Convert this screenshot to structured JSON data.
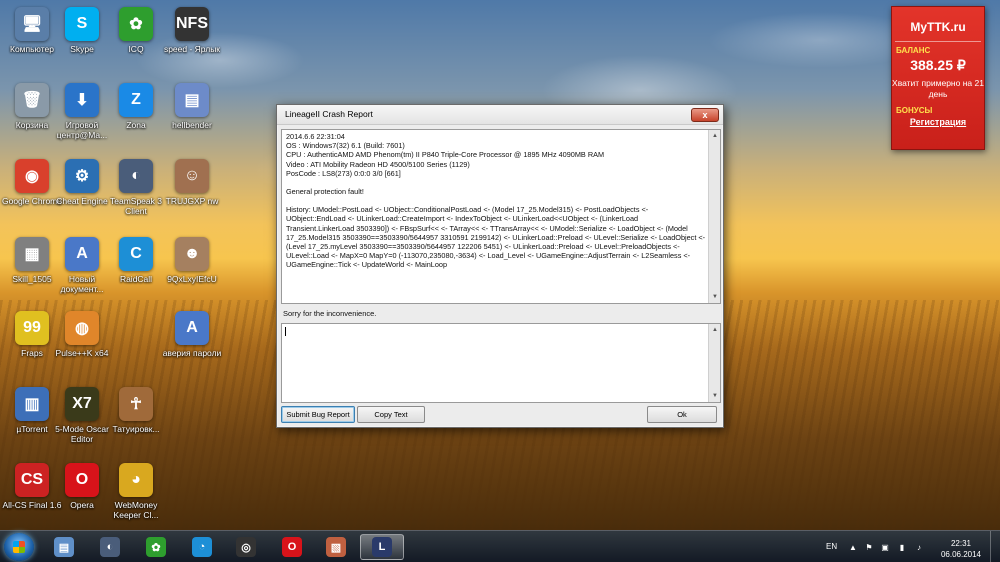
{
  "desktop_icons": [
    {
      "label": "Компьютер",
      "glyph": "🖥",
      "color": "#5a7ea8"
    },
    {
      "label": "Skype",
      "glyph": "S",
      "color": "#00aff0"
    },
    {
      "label": "ICQ",
      "glyph": "✿",
      "color": "#2e9e2e"
    },
    {
      "label": "speed - Ярлык",
      "glyph": "NFS",
      "color": "#333333"
    },
    {
      "label": "Корзина",
      "glyph": "🗑",
      "color": "#8a9aa8"
    },
    {
      "label": "Игровой центр@Ма...",
      "glyph": "⬇",
      "color": "#2a74c9"
    },
    {
      "label": "Zona",
      "glyph": "Z",
      "color": "#1a8ae6"
    },
    {
      "label": "hellbender",
      "glyph": "▤",
      "color": "#6d8bc9"
    },
    {
      "label": "Google Chrome",
      "glyph": "◉",
      "color": "#d9402c"
    },
    {
      "label": "Cheat Engine",
      "glyph": "⚙",
      "color": "#2b6fb3"
    },
    {
      "label": "TeamSpeak 3 Client",
      "glyph": "◐",
      "color": "#4a5d7a"
    },
    {
      "label": "TRUJGXP nw",
      "glyph": "☺",
      "color": "#a07050"
    },
    {
      "label": "Skill_1505",
      "glyph": "▦",
      "color": "#808080"
    },
    {
      "label": "Новый документ...",
      "glyph": "A",
      "color": "#4a78c8"
    },
    {
      "label": "RaidCall",
      "glyph": "C",
      "color": "#1d8fd6"
    },
    {
      "label": "9QxLxyIEfcU",
      "glyph": "☻",
      "color": "#a58060"
    },
    {
      "label": "Fraps",
      "glyph": "99",
      "color": "#e0c020"
    },
    {
      "label": "Pulse++K x64",
      "glyph": "◍",
      "color": "#e0862a"
    },
    {
      "label": "аверия пароли",
      "glyph": "A",
      "color": "#4a78c8"
    },
    {
      "label": "µTorrent",
      "glyph": "▥",
      "color": "#3d6fb8"
    },
    {
      "label": "5-Mode Oscar Editor",
      "glyph": "X7",
      "color": "#3a3a1a"
    },
    {
      "label": "Татуировк...",
      "glyph": "☥",
      "color": "#a06a3a"
    },
    {
      "label": "All-CS Final 1.6",
      "glyph": "CS",
      "color": "#c22"
    },
    {
      "label": "Opera",
      "glyph": "O",
      "color": "#d8131a"
    },
    {
      "label": "WebMoney Keeper Cl...",
      "glyph": "◕",
      "color": "#d9a81f"
    }
  ],
  "crash_window": {
    "title": "LineageII Crash Report",
    "close_glyph": "x",
    "scroll_up": "▲",
    "scroll_down": "▼",
    "log_lines": [
      "2014.6.6 22:31:04",
      "OS : Windows7(32) 6.1 (Build: 7601)",
      "CPU : AuthenticAMD  AMD Phenom(tm) II P840 Triple-Core Processor @ 1895 MHz 4090MB RAM",
      "Video : ATI Mobility Radeon HD 4500/5100 Series (1129)",
      "PosCode : LS8(273) 0:0:0 3/0 [661]",
      "",
      "General protection fault!",
      "",
      "History: UModel::PostLoad <- UObject::ConditionalPostLoad <- (Model 17_25.Model315) <- PostLoadObjects <- UObject::EndLoad <- ULinkerLoad::CreateImport <- IndexToObject <- ULinkerLoad<<UObject <- (LinkerLoad Transient.LinkerLoad 3503390]) <- FBspSurf<< <- TArray<< <- TTransArray<< <- UModel::Serialize <- LoadObject <- (Model 17_25.Model315 3503390==3503390/5644957 3310591 2199142) <- ULinkerLoad::Preload <- ULevel::Serialize <- LoadObject <- (Level 17_25.myLevel 3503390==3503390/5644957 122206 5451) <- ULinkerLoad::Preload <- ULevel::PreloadObjects <- ULevel::Load <- MapX=0 MapY=0 (-113070,235080,-3634) <- Load_Level <- UGameEngine::AdjustTerrain <- L2Seamless <- UGameEngine::Tick <- UpdateWorld <- MainLoop"
    ],
    "sorry_text": "Sorry for the inconvenience.",
    "input_value": "",
    "buttons": {
      "submit": "Submit Bug Report",
      "copy": "Copy Text",
      "ok": "Ok"
    }
  },
  "ttk_widget": {
    "brand": "MyTTK.ru",
    "balance_heading": "БАЛАНС",
    "balance": "388.25 ₽",
    "note": "Хватит примерно на 21 день",
    "bonus_heading": "БОНУСЫ",
    "register_link": "Регистрация"
  },
  "taskbar": {
    "items": [
      {
        "name": "explorer",
        "glyph": "▤",
        "color": "#5f8fc8",
        "active": false
      },
      {
        "name": "teamspeak",
        "glyph": "◐",
        "color": "#4a5d7a",
        "active": false
      },
      {
        "name": "icq",
        "glyph": "✿",
        "color": "#2e9e2e",
        "active": false
      },
      {
        "name": "raidcall",
        "glyph": "◔",
        "color": "#1d8fd6",
        "active": false
      },
      {
        "name": "steam",
        "glyph": "◎",
        "color": "#333333",
        "active": false
      },
      {
        "name": "opera",
        "glyph": "O",
        "color": "#d8131a",
        "active": false
      },
      {
        "name": "paint",
        "glyph": "▧",
        "color": "#c06040",
        "active": false
      },
      {
        "name": "lineage2",
        "glyph": "L",
        "color": "#2a3a6a",
        "active": true
      }
    ],
    "language": "EN",
    "time": "22:31",
    "date": "06.06.2014"
  }
}
